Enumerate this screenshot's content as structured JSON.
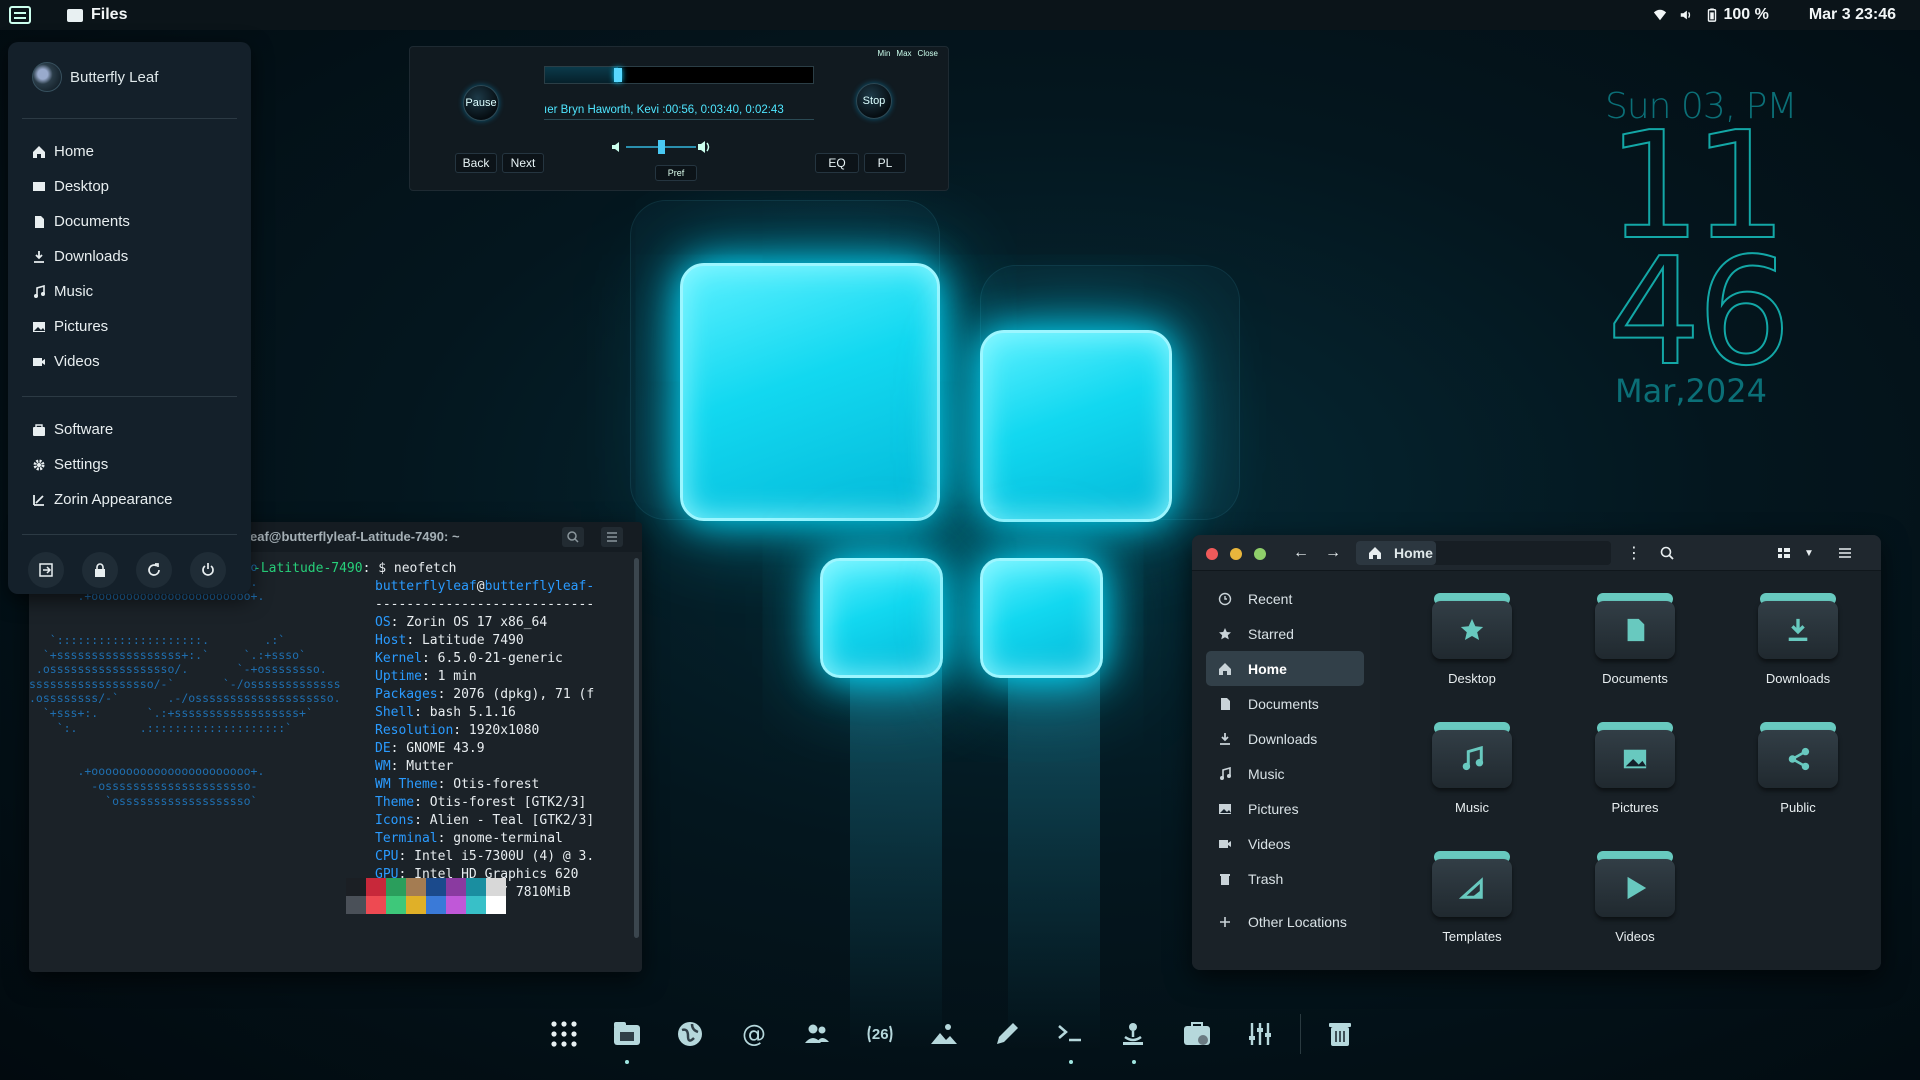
{
  "topbar": {
    "app_name": "Files",
    "battery": "100 %",
    "clock": "Mar 3  23:46",
    "icons": [
      "zorin-menu-icon",
      "wifi-icon",
      "volume-icon",
      "battery-icon"
    ]
  },
  "app_menu": {
    "user": "Butterfly Leaf",
    "places": [
      {
        "label": "Home",
        "icon": "home-icon"
      },
      {
        "label": "Desktop",
        "icon": "desktop-icon"
      },
      {
        "label": "Documents",
        "icon": "document-icon"
      },
      {
        "label": "Downloads",
        "icon": "download-icon"
      },
      {
        "label": "Music",
        "icon": "music-icon"
      },
      {
        "label": "Pictures",
        "icon": "pictures-icon"
      },
      {
        "label": "Videos",
        "icon": "video-icon"
      }
    ],
    "system": [
      {
        "label": "Software",
        "icon": "software-icon"
      },
      {
        "label": "Settings",
        "icon": "gear-icon"
      },
      {
        "label": "Zorin Appearance",
        "icon": "appearance-icon"
      }
    ],
    "actions": [
      "logout-icon",
      "lock-icon",
      "restart-icon",
      "power-icon"
    ]
  },
  "player": {
    "win_min": "Min",
    "win_max": "Max",
    "win_close": "Close",
    "pause": "Pause",
    "stop": "Stop",
    "back": "Back",
    "next": "Next",
    "eq": "EQ",
    "pl": "PL",
    "pref": "Pref",
    "title": "ıer   Bryn Haworth, Kevi  :00:56, 0:03:40, 0:02:43",
    "progress": 0.27,
    "volume": 0.5
  },
  "clock_widget": {
    "day": "Sun 03, PM",
    "hour": "11",
    "minute": "46",
    "date": "Mar,2024"
  },
  "terminal": {
    "title": "eaf@butterflyleaf-Latitude-7490: ~",
    "prompt": "-Latitude-7490: $ neofetch",
    "user_host": "butterflyleaf@butterflyleaf-",
    "divider": "----------------------------",
    "info": [
      {
        "k": "OS",
        "v": ": Zorin OS 17 x86_64"
      },
      {
        "k": "Host",
        "v": ": Latitude 7490"
      },
      {
        "k": "Kernel",
        "v": ": 6.5.0-21-generic"
      },
      {
        "k": "Uptime",
        "v": ": 1 min"
      },
      {
        "k": "Packages",
        "v": ": 2076 (dpkg), 71 (f"
      },
      {
        "k": "Shell",
        "v": ": bash 5.1.16"
      },
      {
        "k": "Resolution",
        "v": ": 1920x1080"
      },
      {
        "k": "DE",
        "v": ": GNOME 43.9"
      },
      {
        "k": "WM",
        "v": ": Mutter"
      },
      {
        "k": "WM Theme",
        "v": ": Otis-forest"
      },
      {
        "k": "Theme",
        "v": ": Otis-forest [GTK2/3]"
      },
      {
        "k": "Icons",
        "v": ": Alien - Teal [GTK2/3]"
      },
      {
        "k": "Terminal",
        "v": ": gnome-terminal"
      },
      {
        "k": "CPU",
        "v": ": Intel i5-7300U (4) @ 3."
      },
      {
        "k": "GPU",
        "v": ": Intel HD Graphics 620"
      },
      {
        "k": "Memory",
        "v": ": 1131MiB / 7810MiB"
      }
    ],
    "palette": [
      "#1b1f24",
      "#c8283a",
      "#2a9e5c",
      "#a47c52",
      "#1b4a8c",
      "#8a3aa0",
      "#1a8ea0",
      "#d8d8d8",
      "#4a5058",
      "#ee4a52",
      "#3ec87a",
      "#e0b028",
      "#3a7ad8",
      "#c058d8",
      "#38c0c8",
      "#ffffff"
    ]
  },
  "files": {
    "location": "Home",
    "sidebar": [
      {
        "label": "Recent",
        "icon": "recent-icon"
      },
      {
        "label": "Starred",
        "icon": "star-icon"
      },
      {
        "label": "Home",
        "icon": "home-icon",
        "active": true
      },
      {
        "label": "Documents",
        "icon": "document-icon"
      },
      {
        "label": "Downloads",
        "icon": "download-icon"
      },
      {
        "label": "Music",
        "icon": "music-icon"
      },
      {
        "label": "Pictures",
        "icon": "pictures-icon"
      },
      {
        "label": "Videos",
        "icon": "video-icon"
      },
      {
        "label": "Trash",
        "icon": "trash-icon"
      },
      {
        "label": "Other Locations",
        "icon": "plus-icon"
      }
    ],
    "folders": [
      {
        "label": "Desktop",
        "icon": "star-icon"
      },
      {
        "label": "Documents",
        "icon": "document-icon"
      },
      {
        "label": "Downloads",
        "icon": "download-icon"
      },
      {
        "label": "Music",
        "icon": "music-icon"
      },
      {
        "label": "Pictures",
        "icon": "pictures-icon"
      },
      {
        "label": "Public",
        "icon": "share-icon"
      },
      {
        "label": "Templates",
        "icon": "templates-icon"
      },
      {
        "label": "Videos",
        "icon": "play-icon"
      }
    ]
  },
  "dock": {
    "apps": [
      {
        "name": "app-grid-icon",
        "running": false
      },
      {
        "name": "files-icon",
        "running": true
      },
      {
        "name": "browser-icon",
        "running": false
      },
      {
        "name": "mail-icon",
        "running": false
      },
      {
        "name": "contacts-icon",
        "running": false
      },
      {
        "name": "calendar-icon",
        "running": false
      },
      {
        "name": "photos-icon",
        "running": false
      },
      {
        "name": "text-editor-icon",
        "running": false
      },
      {
        "name": "terminal-icon",
        "running": true
      },
      {
        "name": "audio-player-icon",
        "running": true
      },
      {
        "name": "software-store-icon",
        "running": false
      },
      {
        "name": "mixer-icon",
        "running": false
      },
      {
        "name": "trash-icon",
        "running": false
      }
    ],
    "calendar_day": "26"
  },
  "colors": {
    "accent": "#68c9bf",
    "glow": "#12d8f0",
    "terminal_key": "#2a9bff",
    "clock": "#13a7a6"
  }
}
